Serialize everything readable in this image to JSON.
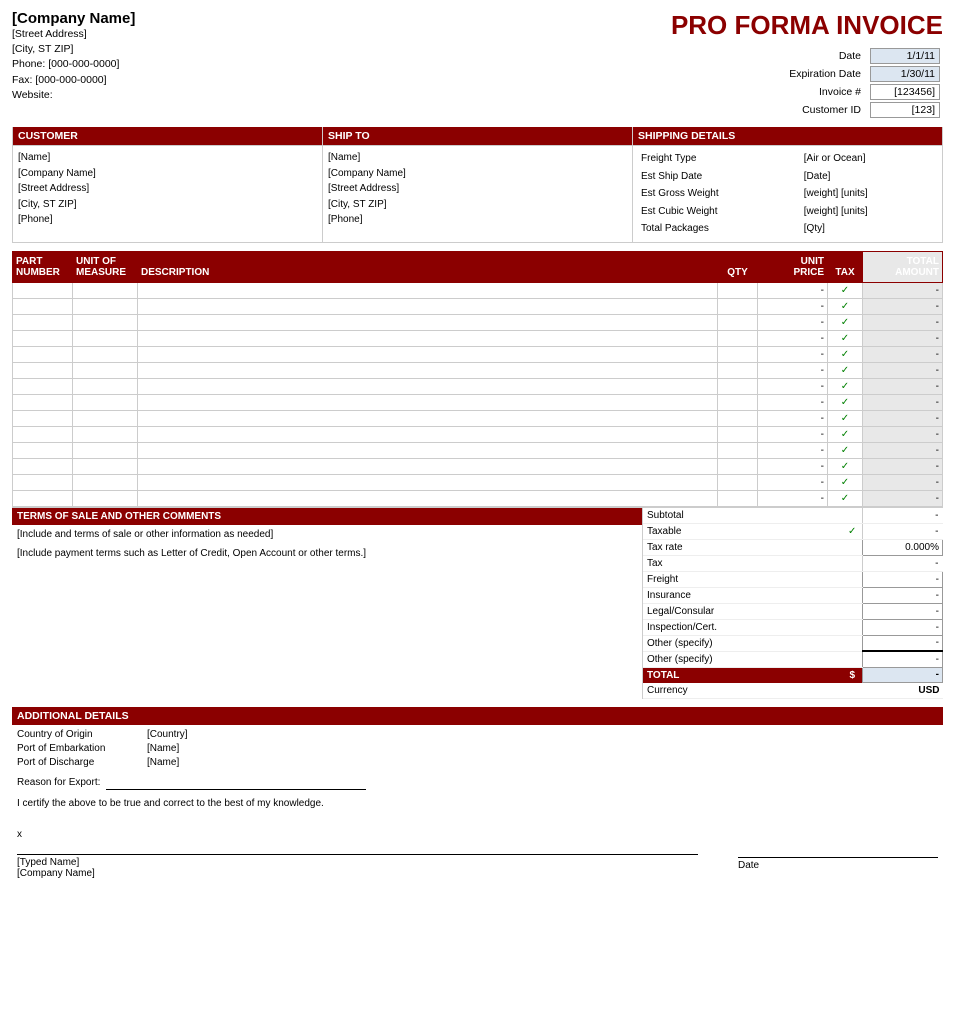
{
  "header": {
    "company_name": "[Company Name]",
    "street": "[Street Address]",
    "city": "[City, ST  ZIP]",
    "phone": "Phone: [000-000-0000]",
    "fax": "Fax: [000-000-0000]",
    "website": "Website:",
    "invoice_title": "PRO FORMA INVOICE",
    "date_label": "Date",
    "date_value": "1/1/11",
    "expiration_label": "Expiration Date",
    "expiration_value": "1/30/11",
    "invoice_num_label": "Invoice #",
    "invoice_num_value": "[123456]",
    "customer_id_label": "Customer ID",
    "customer_id_value": "[123]"
  },
  "customer": {
    "header": "CUSTOMER",
    "name": "[Name]",
    "company": "[Company Name]",
    "street": "[Street Address]",
    "city": "[City, ST  ZIP]",
    "phone": "[Phone]"
  },
  "ship_to": {
    "header": "SHIP TO",
    "name": "[Name]",
    "company": "[Company Name]",
    "street": "[Street Address]",
    "city": "[City, ST  ZIP]",
    "phone": "[Phone]"
  },
  "shipping_details": {
    "header": "SHIPPING DETAILS",
    "freight_label": "Freight Type",
    "freight_val": "[Air or Ocean]",
    "ship_date_label": "Est Ship Date",
    "ship_date_val": "[Date]",
    "gross_weight_label": "Est Gross Weight",
    "gross_weight_val": "[weight] [units]",
    "cubic_weight_label": "Est Cubic Weight",
    "cubic_weight_val": "[weight] [units]",
    "packages_label": "Total Packages",
    "packages_val": "[Qty]"
  },
  "table": {
    "col_part": "PART\nNUMBER",
    "col_uom": "UNIT OF\nMEASURE",
    "col_desc": "DESCRIPTION",
    "col_qty": "QTY",
    "col_price": "UNIT\nPRICE",
    "col_tax": "TAX",
    "col_total": "TOTAL AMOUNT",
    "rows": [
      {
        "part": "",
        "uom": "",
        "desc": "",
        "qty": "",
        "price": "-",
        "tax": "✓",
        "total": "-"
      },
      {
        "part": "",
        "uom": "",
        "desc": "",
        "qty": "",
        "price": "-",
        "tax": "✓",
        "total": "-"
      },
      {
        "part": "",
        "uom": "",
        "desc": "",
        "qty": "",
        "price": "-",
        "tax": "✓",
        "total": "-"
      },
      {
        "part": "",
        "uom": "",
        "desc": "",
        "qty": "",
        "price": "-",
        "tax": "✓",
        "total": "-"
      },
      {
        "part": "",
        "uom": "",
        "desc": "",
        "qty": "",
        "price": "-",
        "tax": "✓",
        "total": "-"
      },
      {
        "part": "",
        "uom": "",
        "desc": "",
        "qty": "",
        "price": "-",
        "tax": "✓",
        "total": "-"
      },
      {
        "part": "",
        "uom": "",
        "desc": "",
        "qty": "",
        "price": "-",
        "tax": "✓",
        "total": "-"
      },
      {
        "part": "",
        "uom": "",
        "desc": "",
        "qty": "",
        "price": "-",
        "tax": "✓",
        "total": "-"
      },
      {
        "part": "",
        "uom": "",
        "desc": "",
        "qty": "",
        "price": "-",
        "tax": "✓",
        "total": "-"
      },
      {
        "part": "",
        "uom": "",
        "desc": "",
        "qty": "",
        "price": "-",
        "tax": "✓",
        "total": "-"
      },
      {
        "part": "",
        "uom": "",
        "desc": "",
        "qty": "",
        "price": "-",
        "tax": "✓",
        "total": "-"
      },
      {
        "part": "",
        "uom": "",
        "desc": "",
        "qty": "",
        "price": "-",
        "tax": "✓",
        "total": "-"
      },
      {
        "part": "",
        "uom": "",
        "desc": "",
        "qty": "",
        "price": "-",
        "tax": "✓",
        "total": "-"
      },
      {
        "part": "",
        "uom": "",
        "desc": "",
        "qty": "",
        "price": "-",
        "tax": "✓",
        "total": "-"
      }
    ]
  },
  "terms": {
    "header": "TERMS OF SALE AND OTHER COMMENTS",
    "line1": "[Include and terms of sale or other information as needed]",
    "line2": "[Include payment terms such as Letter of Credit, Open Account or other terms.]"
  },
  "totals": {
    "subtotal_label": "Subtotal",
    "subtotal_val": "-",
    "taxable_label": "Taxable",
    "taxable_val": "-",
    "taxrate_label": "Tax rate",
    "taxrate_val": "0.000%",
    "tax_label": "Tax",
    "tax_val": "-",
    "freight_label": "Freight",
    "freight_val": "-",
    "insurance_label": "Insurance",
    "insurance_val": "-",
    "legal_label": "Legal/Consular",
    "legal_val": "-",
    "inspection_label": "Inspection/Cert.",
    "inspection_val": "-",
    "other1_label": "Other (specify)",
    "other1_val": "-",
    "other2_label": "Other (specify)",
    "other2_val": "-",
    "total_label": "TOTAL",
    "total_dollar": "$",
    "total_val": "-",
    "currency_label": "Currency",
    "currency_val": "USD"
  },
  "additional": {
    "header": "ADDITIONAL DETAILS",
    "origin_label": "Country of Origin",
    "origin_val": "[Country]",
    "embark_label": "Port of Embarkation",
    "embark_val": "[Name]",
    "discharge_label": "Port of Discharge",
    "discharge_val": "[Name]",
    "reason_label": "Reason for Export:",
    "certify_text": "I certify the above to be true and correct to the best of my knowledge.",
    "sig_x": "x",
    "sig_typed_name": "[Typed Name]",
    "sig_company": "[Company Name]",
    "sig_date_label": "Date"
  }
}
